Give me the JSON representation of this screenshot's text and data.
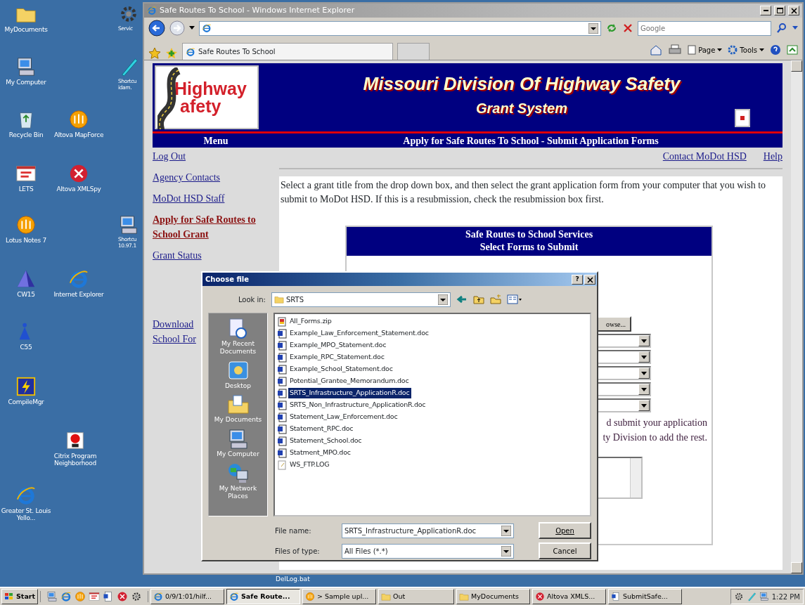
{
  "desktop": {
    "icons": [
      {
        "label": "MyDocuments",
        "kind": "folder"
      },
      {
        "label": "My Computer",
        "kind": "computer"
      },
      {
        "label": "Recycle Bin",
        "kind": "bin"
      },
      {
        "label": "LETS",
        "kind": "window-app"
      },
      {
        "label": "Lotus Notes 7",
        "kind": "orange-disc"
      },
      {
        "label": "CW15",
        "kind": "triangle"
      },
      {
        "label": "C55",
        "kind": "figure"
      },
      {
        "label": "CompileMgr",
        "kind": "bolt"
      },
      {
        "label": "Greater St. Louis Yello...",
        "kind": "browser"
      },
      {
        "label": "Altova MapForce",
        "kind": "orange-disc"
      },
      {
        "label": "Altova XMLSpy",
        "kind": "red-disc"
      },
      {
        "label": "Internet Explorer",
        "kind": "browser"
      },
      {
        "label": "Citrix Program Neighborhood",
        "kind": "red-dot"
      },
      {
        "label": "Servic",
        "kind": "gear"
      },
      {
        "label": "Shortcu idam.",
        "kind": "pen"
      },
      {
        "label": "Shortcu 10.97.1",
        "kind": "computer"
      }
    ],
    "labels": [
      "DelLog.bat"
    ]
  },
  "browser": {
    "title": "Safe Routes To School - Windows Internet Explorer",
    "search": {
      "placeholder": "Google"
    },
    "tabs": [
      {
        "label": "Safe Routes To School",
        "selected": true
      }
    ],
    "commands": [
      {
        "label": "Page"
      },
      {
        "label": "Tools"
      }
    ]
  },
  "page": {
    "logo": {
      "line_1": "Highway",
      "line_2": "afety"
    },
    "title": "Missouri Division Of Highway Safety",
    "subtitle": "Grant System",
    "menu_heading": "Menu",
    "section_heading": "Apply for Safe Routes To School - Submit Application Forms",
    "menu": [
      {
        "label": "Log Out",
        "selected": false
      },
      {
        "label": "Agency Contacts",
        "selected": false
      },
      {
        "label": "MoDot HSD Staff",
        "selected": false
      },
      {
        "label": "Apply for Safe Routes to School Grant",
        "selected": true
      },
      {
        "label": "Grant Status",
        "selected": false
      },
      {
        "label": "Download School For",
        "selected": false
      }
    ],
    "top_links": [
      "Contact MoDot HSD",
      "Help"
    ],
    "intro": "Select a grant title from the drop down box, and then select the grant application form from your computer that you wish to submit to MoDot HSD. If this is a resubmission, check the resubmission box first.",
    "panel": {
      "heading_1": "Safe Routes to School Services",
      "heading_2": "Select Forms to Submit",
      "browse_button": "owse...",
      "note_lines": [
        "d submit your application",
        "ty Division to add the rest."
      ]
    }
  },
  "dialog": {
    "title": "Choose file",
    "help_button": "?",
    "look_in_label": "Look in:",
    "look_in": "SRTS",
    "places": [
      {
        "label": "My Recent Documents",
        "kind": "recent"
      },
      {
        "label": "Desktop",
        "kind": "desktop"
      },
      {
        "label": "My Documents",
        "kind": "documents"
      },
      {
        "label": "My Computer",
        "kind": "computer"
      },
      {
        "label": "My Network Places",
        "kind": "network"
      }
    ],
    "files": [
      {
        "name": "All_Forms.zip",
        "kind": "zip",
        "selected": false
      },
      {
        "name": "Example_Law_Enforcement_Statement.doc",
        "kind": "doc",
        "selected": false
      },
      {
        "name": "Example_MPO_Statement.doc",
        "kind": "doc",
        "selected": false
      },
      {
        "name": "Example_RPC_Statement.doc",
        "kind": "doc",
        "selected": false
      },
      {
        "name": "Example_School_Statement.doc",
        "kind": "doc",
        "selected": false
      },
      {
        "name": "Potential_Grantee_Memorandum.doc",
        "kind": "doc",
        "selected": false
      },
      {
        "name": "SRTS_Infrastructure_ApplicationR.doc",
        "kind": "doc",
        "selected": true
      },
      {
        "name": "SRTS_Non_Infrastructure_ApplicationR.doc",
        "kind": "doc",
        "selected": false
      },
      {
        "name": "Statement_Law_Enforcement.doc",
        "kind": "doc",
        "selected": false
      },
      {
        "name": "Statement_RPC.doc",
        "kind": "doc",
        "selected": false
      },
      {
        "name": "Statement_School.doc",
        "kind": "doc",
        "selected": false
      },
      {
        "name": "Statment_MPO.doc",
        "kind": "doc",
        "selected": false
      },
      {
        "name": "WS_FTP.LOG",
        "kind": "text",
        "selected": false
      }
    ],
    "file_name_label": "File name:",
    "file_name": "SRTS_Infrastructure_ApplicationR.doc",
    "file_type_label": "Files of type:",
    "file_type": "All Files (*.*)",
    "open_button": "Open",
    "cancel_button": "Cancel"
  },
  "taskbar": {
    "start": "Start",
    "tasks": [
      {
        "label": "0/9/1:01/hilf...",
        "kind": "browser",
        "selected": false
      },
      {
        "label": "Safe Route...",
        "kind": "browser",
        "selected": true
      },
      {
        "label": "> Sample upl...",
        "kind": "orange-disc",
        "selected": false
      },
      {
        "label": "Out",
        "kind": "folder",
        "selected": false
      },
      {
        "label": "MyDocuments",
        "kind": "folder",
        "selected": false
      },
      {
        "label": "Altova XMLS...",
        "kind": "red-disc",
        "selected": false
      },
      {
        "label": "SubmitSafe...",
        "kind": "document",
        "selected": false
      }
    ],
    "clock": "1:22 PM"
  }
}
